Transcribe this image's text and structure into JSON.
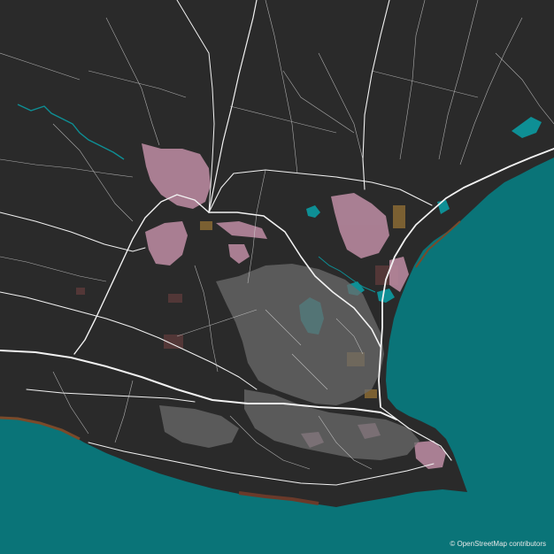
{
  "attribution": "© OpenStreetMap contributors",
  "colors": {
    "land": "#2a2a2a",
    "sea": "#0a7478",
    "water": "#0e8f95",
    "roads": "#f2f2f2",
    "residential": "#b7889e",
    "commercial": "#8a6a34",
    "industrial": "#5a3a3a",
    "beach": "#7a4a2a"
  }
}
